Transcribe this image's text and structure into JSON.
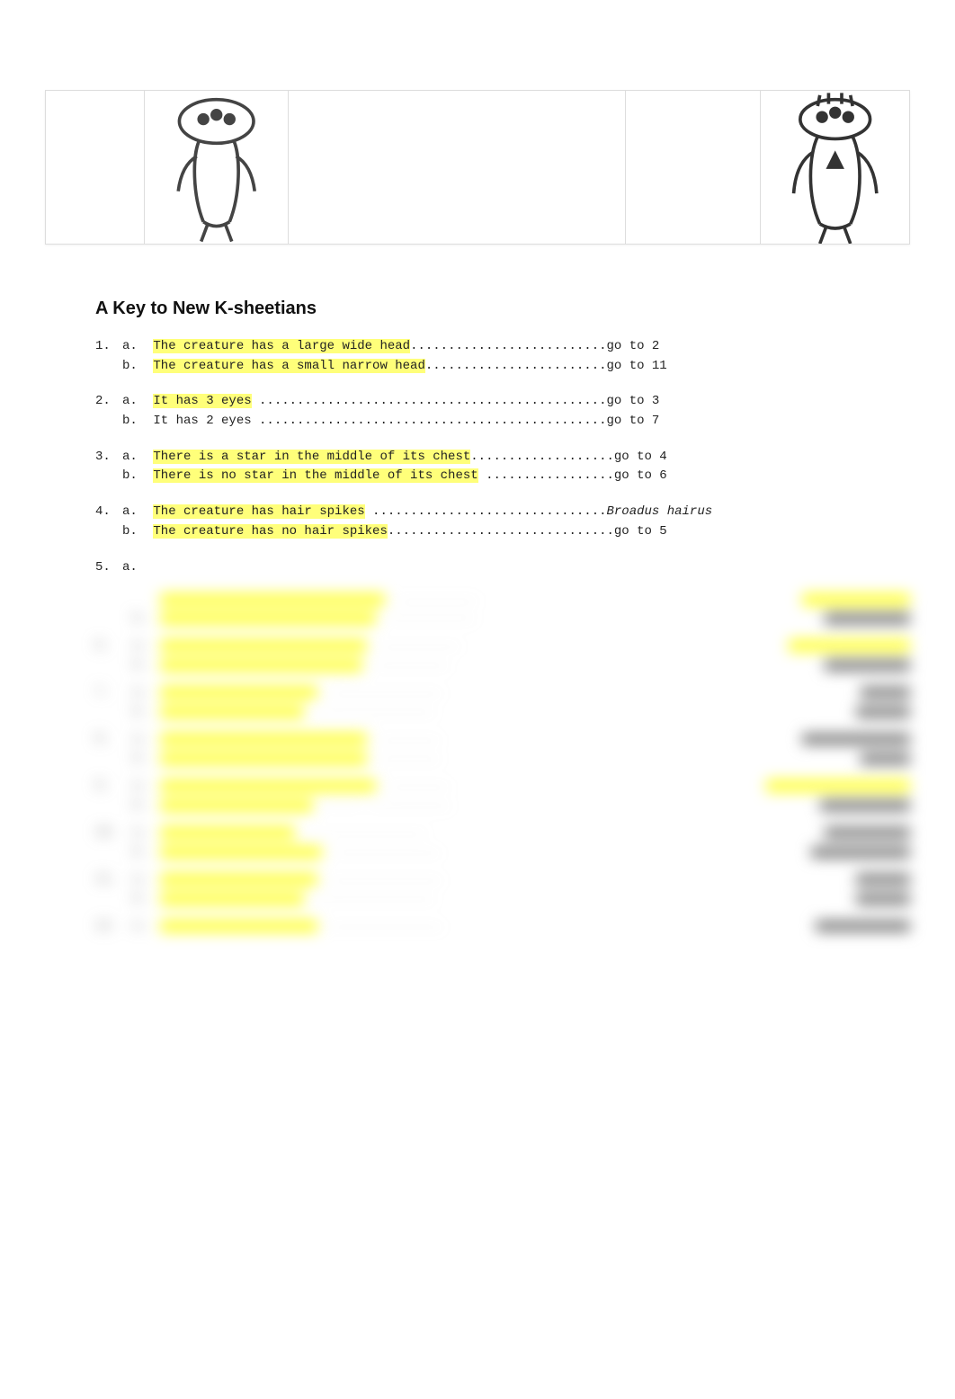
{
  "title": "A Key to New K-sheetians",
  "key": [
    {
      "n": "1.",
      "a": {
        "text": "The creature has a large wide head",
        "dots": "..........................",
        "go": "go to 2",
        "hl": true
      },
      "b": {
        "text": "The creature has a small narrow head",
        "dots": "........................",
        "go": "go to 11",
        "hl": true
      }
    },
    {
      "n": "2.",
      "a": {
        "text": "It has 3 eyes",
        "dots": " ..............................................",
        "go": "go to 3",
        "hl": true
      },
      "b": {
        "text": "It has 2 eyes",
        "dots": " ..............................................",
        "go": "go to 7",
        "hl": false
      }
    },
    {
      "n": "3.",
      "a": {
        "text": "There is a star in the middle of its chest",
        "dots": "...................",
        "go": "go to 4",
        "hl": true
      },
      "b": {
        "text": "There is no star in the middle of its chest",
        "dots": " .................",
        "go": "go to 6",
        "hl": true
      }
    },
    {
      "n": "4.",
      "a": {
        "text": "The creature has hair spikes",
        "dots": " ...............................",
        "go": "Broadus hairus",
        "hl": true,
        "ital": true
      },
      "b": {
        "text": "The creature has no hair spikes",
        "dots": "..............................",
        "go": "go to 5",
        "hl": true
      }
    },
    {
      "n": "5.",
      "a": {
        "text": "",
        "dots": "",
        "go": "",
        "hl": true
      }
    }
  ],
  "blur_rows": [
    {
      "num": "",
      "sub": "",
      "bar": 250,
      "dots": ".............",
      "resType": "hl",
      "res": 120
    },
    {
      "num": "",
      "sub": "b.",
      "bar": 240,
      "dots": "..............",
      "resType": "plain",
      "res": 95
    },
    {
      "group": true
    },
    {
      "num": "6.",
      "sub": "a.",
      "bar": 230,
      "dots": ".............",
      "resType": "hl",
      "res": 135
    },
    {
      "num": "",
      "sub": "b.",
      "bar": 225,
      "dots": "............",
      "resType": "plain",
      "res": 95
    },
    {
      "group": true
    },
    {
      "num": "7.",
      "sub": "a.",
      "bar": 175,
      "dots": "..................",
      "resType": "plain",
      "res": 55
    },
    {
      "num": "",
      "sub": "b.",
      "bar": 160,
      "dots": "...................",
      "resType": "plain",
      "res": 60
    },
    {
      "group": true
    },
    {
      "num": "8.",
      "sub": "a.",
      "bar": 230,
      "dots": "..........",
      "resType": "plain",
      "res": 120
    },
    {
      "num": "",
      "sub": "b.",
      "bar": 230,
      "dots": "..........",
      "resType": "plain",
      "res": 55
    },
    {
      "group": true
    },
    {
      "num": "9.",
      "sub": "a.",
      "bar": 240,
      "dots": "..........",
      "resType": "hl",
      "res": 160
    },
    {
      "num": "",
      "sub": "b.",
      "bar": 170,
      "dots": "......   .............",
      "resType": "plain",
      "res": 100
    },
    {
      "group": true
    },
    {
      "num": "10.",
      "sub": "a.",
      "bar": 150,
      "dots": "...................",
      "resType": "plain",
      "res": 95
    },
    {
      "num": "",
      "sub": "b.",
      "bar": 180,
      "dots": ".................",
      "resType": "plain",
      "res": 110
    },
    {
      "group": true
    },
    {
      "num": "11.",
      "sub": "a.",
      "bar": 175,
      "dots": "..................",
      "resType": "plain",
      "res": 60
    },
    {
      "num": "",
      "sub": "b.",
      "bar": 160,
      "dots": "...................",
      "resType": "plain",
      "res": 60
    },
    {
      "group": true
    },
    {
      "num": "12.",
      "sub": "a.",
      "bar": 175,
      "dots": "..................",
      "resType": "plain",
      "res": 105
    }
  ]
}
